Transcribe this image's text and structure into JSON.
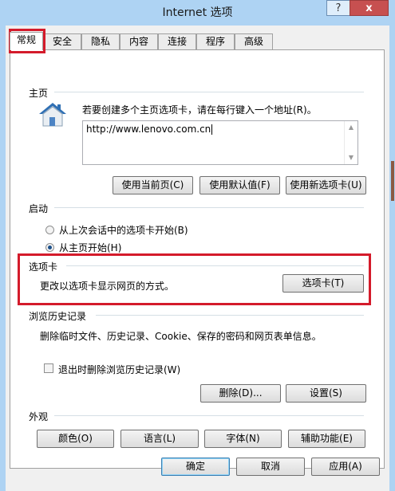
{
  "window": {
    "title": "Internet 选项",
    "help_label": "?",
    "close_label": "x"
  },
  "tabs": [
    "常规",
    "安全",
    "隐私",
    "内容",
    "连接",
    "程序",
    "高级"
  ],
  "home": {
    "section_title": "主页",
    "description": "若要创建多个主页选项卡，请在每行键入一个地址(R)。",
    "url": "http://www.lenovo.com.cn",
    "buttons": [
      "使用当前页(C)",
      "使用默认值(F)",
      "使用新选项卡(U)"
    ]
  },
  "startup": {
    "section_title": "启动",
    "options": [
      {
        "label": "从上次会话中的选项卡开始(B)",
        "selected": false
      },
      {
        "label": "从主页开始(H)",
        "selected": true
      }
    ]
  },
  "tabs_section": {
    "section_title": "选项卡",
    "description": "更改以选项卡显示网页的方式。",
    "button": "选项卡(T)"
  },
  "history": {
    "section_title": "浏览历史记录",
    "description": "删除临时文件、历史记录、Cookie、保存的密码和网页表单信息。",
    "checkbox_label": "退出时删除浏览历史记录(W)",
    "checkbox_checked": false,
    "delete_button": "删除(D)...",
    "settings_button": "设置(S)"
  },
  "appearance": {
    "section_title": "外观",
    "buttons": [
      "颜色(O)",
      "语言(L)",
      "字体(N)",
      "辅助功能(E)"
    ]
  },
  "footer": {
    "ok": "确定",
    "cancel": "取消",
    "apply": "应用(A)"
  },
  "colors": {
    "highlight_box": "#d41b2b",
    "titlebar": "#aed3f3",
    "close_button": "#c75050"
  }
}
